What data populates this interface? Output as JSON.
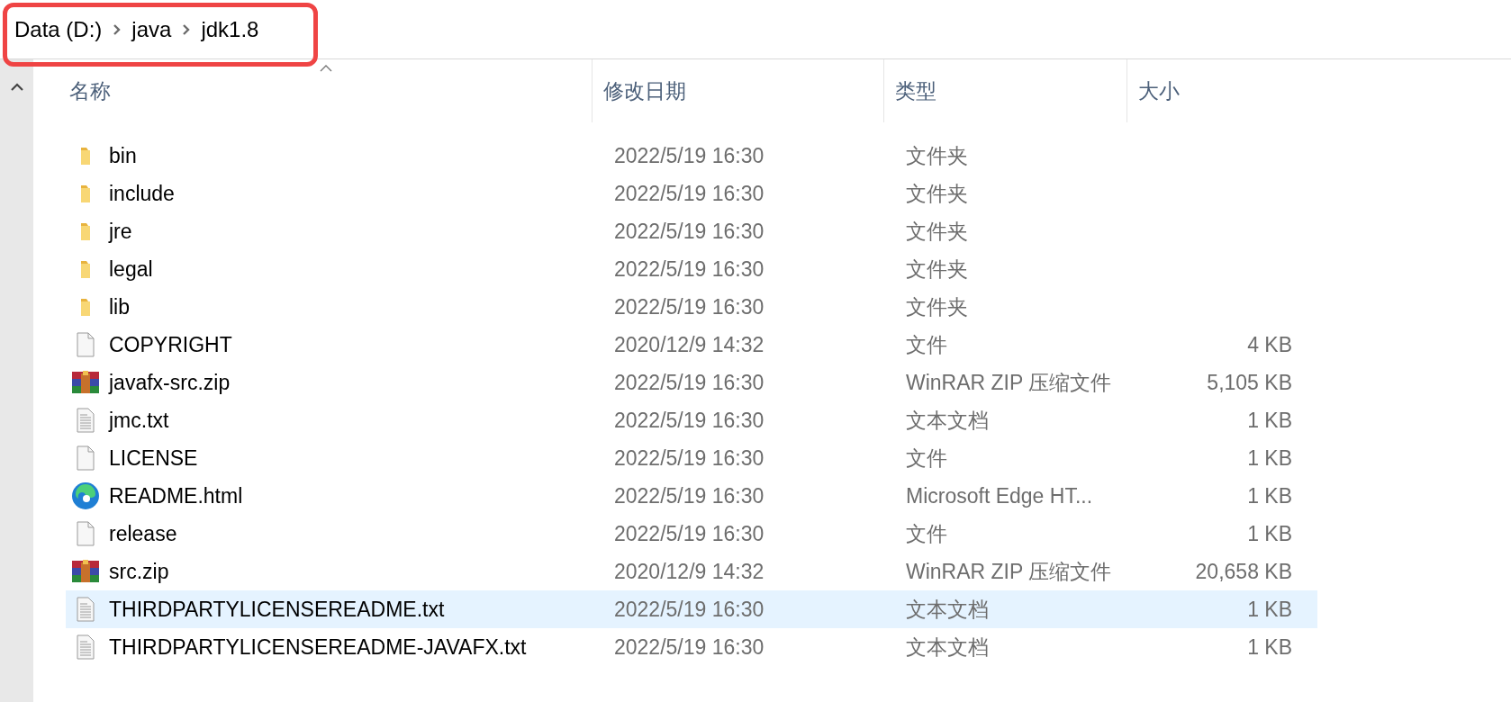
{
  "breadcrumb": [
    "Data (D:)",
    "java",
    "jdk1.8"
  ],
  "columns": [
    {
      "label": "名称",
      "sorted": true
    },
    {
      "label": "修改日期",
      "sorted": false
    },
    {
      "label": "类型",
      "sorted": false
    },
    {
      "label": "大小",
      "sorted": false
    }
  ],
  "rows": [
    {
      "kind": "folder",
      "name": "bin",
      "date": "2022/5/19 16:30",
      "type": "文件夹",
      "selected": false
    },
    {
      "kind": "folder",
      "name": "include",
      "date": "2022/5/19 16:30",
      "type": "文件夹",
      "selected": false
    },
    {
      "kind": "folder",
      "name": "jre",
      "date": "2022/5/19 16:30",
      "type": "文件夹",
      "selected": false
    },
    {
      "kind": "folder",
      "name": "legal",
      "date": "2022/5/19 16:30",
      "type": "文件夹",
      "selected": false
    },
    {
      "kind": "folder",
      "name": "lib",
      "date": "2022/5/19 16:30",
      "type": "文件夹",
      "selected": false
    },
    {
      "kind": "file",
      "name": "COPYRIGHT",
      "date": "2020/12/9 14:32",
      "type": "文件",
      "size": "4 KB",
      "selected": false
    },
    {
      "kind": "archive",
      "name": "javafx-src.zip",
      "date": "2022/5/19 16:30",
      "type": "WinRAR ZIP 压缩文件",
      "size": "5,105 KB",
      "selected": false
    },
    {
      "kind": "text",
      "name": "jmc.txt",
      "date": "2022/5/19 16:30",
      "type": "文本文档",
      "size": "1 KB",
      "selected": false
    },
    {
      "kind": "file",
      "name": "LICENSE",
      "date": "2022/5/19 16:30",
      "type": "文件",
      "size": "1 KB",
      "selected": false
    },
    {
      "kind": "web",
      "name": "README.html",
      "date": "2022/5/19 16:30",
      "type": "Microsoft Edge HT...",
      "size": "1 KB",
      "selected": false
    },
    {
      "kind": "file",
      "name": "release",
      "date": "2022/5/19 16:30",
      "type": "文件",
      "size": "1 KB",
      "selected": false
    },
    {
      "kind": "archive",
      "name": "src.zip",
      "date": "2020/12/9 14:32",
      "type": "WinRAR ZIP 压缩文件",
      "size": "20,658 KB",
      "selected": false
    },
    {
      "kind": "text",
      "name": "THIRDPARTYLICENSEREADME.txt",
      "date": "2022/5/19 16:30",
      "type": "文本文档",
      "size": "1 KB",
      "selected": true
    },
    {
      "kind": "text",
      "name": "THIRDPARTYLICENSEREADME-JAVAFX.txt",
      "date": "2022/5/19 16:30",
      "type": "文本文档",
      "size": "1 KB",
      "selected": false
    }
  ]
}
